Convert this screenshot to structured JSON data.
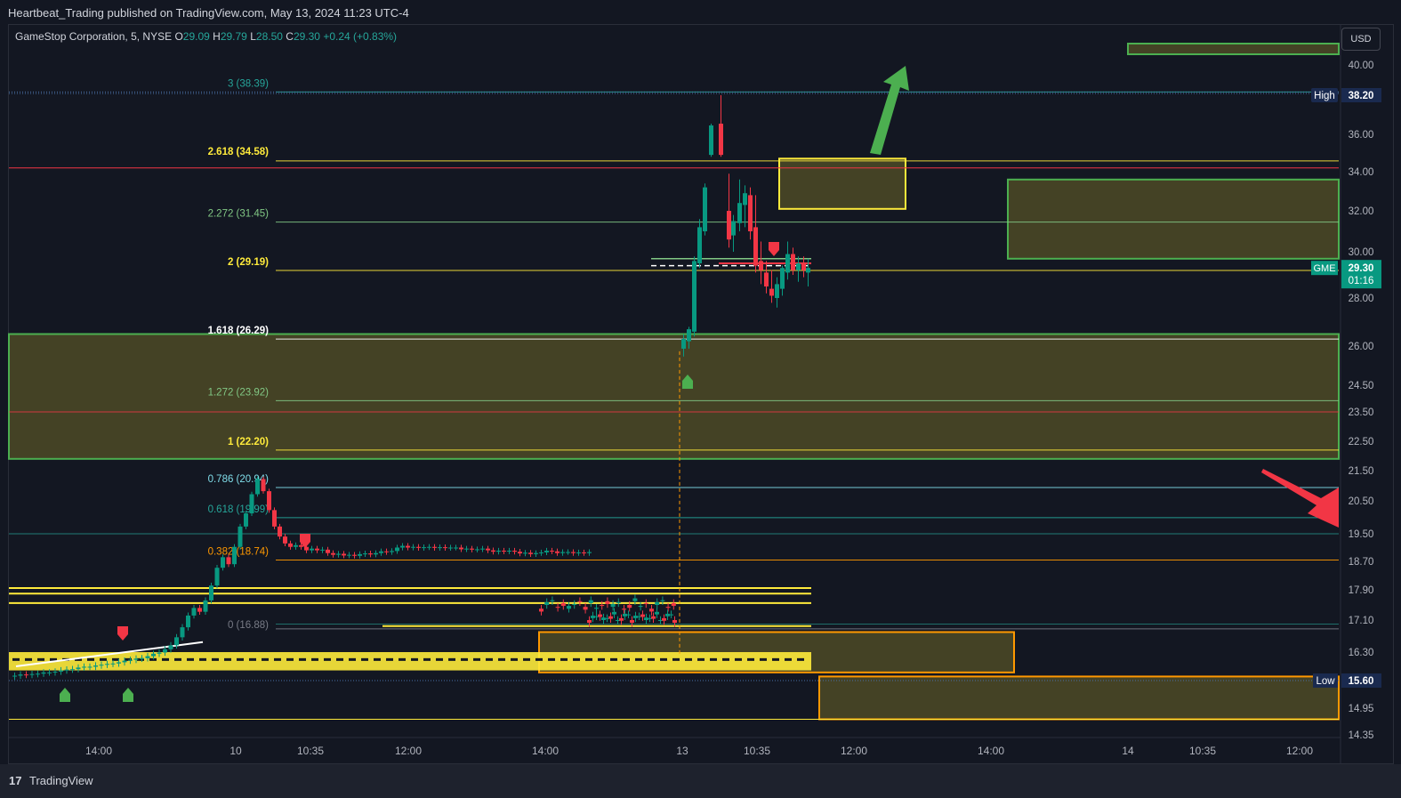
{
  "header": {
    "publish_line": "Heartbeat_Trading published on TradingView.com, May 13, 2024 11:23 UTC-4"
  },
  "legend": {
    "symbol": "GameStop Corporation, 5, NYSE",
    "o_label": "O",
    "o_value": "29.09",
    "h_label": "H",
    "h_value": "29.79",
    "l_label": "L",
    "l_value": "28.50",
    "c_label": "C",
    "c_value": "29.30",
    "change": "+0.24 (+0.83%)"
  },
  "currency": "USD",
  "footer": {
    "logo_glyph": "17",
    "brand": "TradingView"
  },
  "colors": {
    "background": "#131722",
    "up": "#26a69a",
    "down": "#f23645",
    "up_candle": "#089981",
    "fib_yellow": "#ffeb3b",
    "zone_green": "#4caf50",
    "zone_orange": "#ff9800",
    "zone_fill": "#4d4a26",
    "arrow_green": "#4caf50",
    "arrow_red": "#f23645"
  },
  "chart_data": {
    "type": "candlestick",
    "symbol": "GME",
    "timeframe": "5",
    "price_axis": [
      "40.00",
      "38.20",
      "36.00",
      "34.00",
      "32.00",
      "30.00",
      "29.30",
      "28.00",
      "26.00",
      "24.50",
      "23.50",
      "22.50",
      "21.50",
      "20.50",
      "19.50",
      "18.70",
      "17.90",
      "17.10",
      "16.30",
      "15.60",
      "14.95",
      "14.35"
    ],
    "time_axis": [
      "14:00",
      "10",
      "10:35",
      "12:00",
      "14:00",
      "13",
      "10:35",
      "12:00",
      "14:00",
      "14",
      "10:35",
      "12:00"
    ],
    "fib_levels": [
      {
        "label": "3 (38.39)",
        "value": 38.39
      },
      {
        "label": "2.618 (34.58)",
        "value": 34.58
      },
      {
        "label": "2.272 (31.45)",
        "value": 31.45
      },
      {
        "label": "2 (29.19)",
        "value": 29.19
      },
      {
        "label": "1.618 (26.29)",
        "value": 26.29
      },
      {
        "label": "1.272 (23.92)",
        "value": 23.92
      },
      {
        "label": "1 (22.20)",
        "value": 22.2
      },
      {
        "label": "0.786 (20.94)",
        "value": 20.94
      },
      {
        "label": "0.618 (19.99)",
        "value": 19.99
      },
      {
        "label": "0.382 (18.74)",
        "value": 18.74
      },
      {
        "label": "0 (16.88)",
        "value": 16.88
      }
    ],
    "markers": {
      "high": {
        "label": "High",
        "value": "38.20"
      },
      "last": {
        "label": "GME",
        "value": "29.30",
        "countdown": "01:16"
      },
      "low": {
        "label": "Low",
        "value": "15.60"
      }
    },
    "zones": [
      {
        "name": "upper-target-zone",
        "top": 41.2,
        "bottom": 40.6,
        "color": "green"
      },
      {
        "name": "right-target-zone",
        "top": 33.6,
        "bottom": 29.7,
        "color": "green"
      },
      {
        "name": "breakout-zone",
        "top": 34.7,
        "bottom": 32.1,
        "color": "yellow"
      },
      {
        "name": "wide-support-zone",
        "top": 26.5,
        "bottom": 21.9,
        "color": "green"
      },
      {
        "name": "lower-orange-zone-1",
        "top": 16.8,
        "bottom": 15.8,
        "color": "orange"
      },
      {
        "name": "lower-orange-zone-2",
        "top": 15.7,
        "bottom": 14.7,
        "color": "orange"
      }
    ],
    "grid": false
  }
}
